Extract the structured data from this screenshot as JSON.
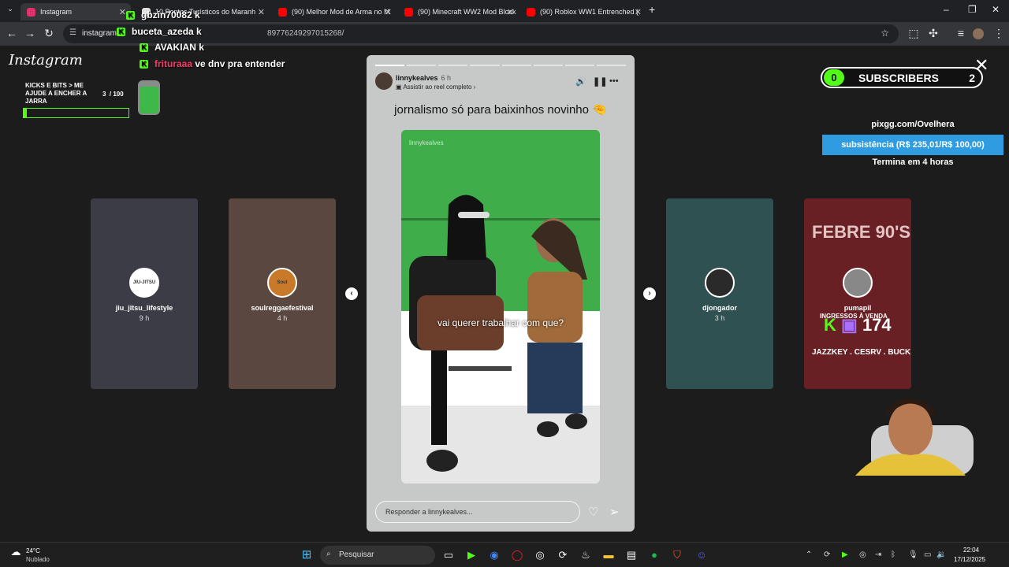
{
  "browser": {
    "tabs": [
      {
        "title": "Instagram",
        "color": "#e1306c",
        "active": true
      },
      {
        "title": "10 Pontos Turísticos do Maranh",
        "color": "#e0e0e0"
      },
      {
        "title": "(90) Melhor Mod de Arma no M",
        "color": "#ff0000"
      },
      {
        "title": "(90) Minecraft WW2 Mod Block",
        "color": "#ff0000"
      },
      {
        "title": "(90) Roblox WW1 Entrenched (",
        "color": "#ff0000"
      }
    ],
    "url_host": "instagram",
    "url_rest": "m",
    "url_tail": "89776249297015268/",
    "window_controls": [
      "–",
      "❐",
      "✕"
    ]
  },
  "instagram": {
    "logo": "Instagram",
    "left_stories": [
      {
        "user": "jiu_jitsu_lifestyle",
        "time": "9 h",
        "avatar_label": "JIU-JITSU",
        "bg": "#556",
        "avatar_bg": "#ffffff"
      },
      {
        "user": "soulreggaefestival",
        "time": "4 h",
        "avatar_label": "Soul Reggae",
        "bg": "#8a6a5c",
        "avatar_bg": "#c87a2a"
      }
    ],
    "right_stories": [
      {
        "user": "djongador",
        "time": "3 h",
        "bg": "#3f7a7a",
        "avatar_bg": "#2a2a2a"
      },
      {
        "user": "pumapil",
        "time": "",
        "bg": "#a4222a",
        "avatar_bg": "#888"
      }
    ],
    "right_story_texts": [
      "FEBRE 90'S",
      "INGRESSOS À VENDA",
      "JAZZKEY . CESRV . BUCK"
    ],
    "story": {
      "user": "linnykealves",
      "time": "6 h",
      "sub": "Assistir ao reel completo",
      "caption": "jornalismo só para baixinhos novinho",
      "caption_emoji": "🤏",
      "video_user": "linnykealves",
      "subtitle": "vai querer trabalhar com que?",
      "reply_placeholder": "Responder a linnykealves...",
      "progress_total": 8,
      "progress_done": 1
    },
    "close_label": "✕",
    "arrow_left": "‹",
    "arrow_right": "›"
  },
  "stream": {
    "chat": [
      {
        "user": "gbzin70082",
        "msg": "k",
        "user_color": "#ffffff"
      },
      {
        "user": "buceta_azeda",
        "msg": "k",
        "user_color": "#ffffff"
      },
      {
        "user": "AVAKIAN",
        "msg": "k",
        "user_color": "#ffffff"
      },
      {
        "user": "frituraaa",
        "msg": "ve dnv pra entender",
        "user_color": "#ff3a6a"
      }
    ],
    "kick_icon": "K",
    "jar_text": [
      "KICKS E BITS > ME",
      "AJUDE A ENCHER A",
      "JARRA"
    ],
    "jar_count": "3",
    "jar_goal": "/ 100",
    "jar_progress": 0.03,
    "subs_count": "0",
    "subs_label": "SUBSCRIBERS",
    "subs_goal": "2",
    "pix_url": "pixgg.com/Ovelhera",
    "pix_goal": "subsistência (R$ 235,01/R$ 100,00)",
    "pix_ends": "Termina em 4 horas",
    "viewers": "174"
  },
  "taskbar": {
    "weather_temp": "24°C",
    "weather_desc": "Nublado",
    "search": "Pesquisar",
    "time": "22:04",
    "date": "17/12/2025"
  }
}
